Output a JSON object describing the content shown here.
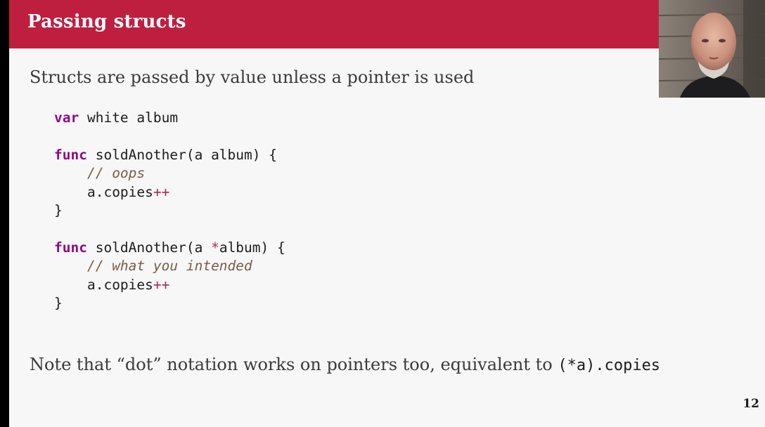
{
  "slide": {
    "title": "Passing structs",
    "lead": "Structs are passed by value unless a pointer is used",
    "code": {
      "line1_kw": "var",
      "line1_rest": " white album",
      "line3_kw": "func",
      "line3_rest": " soldAnother(a album) {",
      "line4_comment": "// oops",
      "line5_text": "a.copies",
      "line5_op": "++",
      "line6": "}",
      "line8_kw": "func",
      "line8_pre": " soldAnother(a ",
      "line8_op": "*",
      "line8_post": "album) {",
      "line9_comment": "// what you intended",
      "line10_text": "a.copies",
      "line10_op": "++",
      "line11": "}"
    },
    "note_text": "Note that “dot” notation works on pointers too, equivalent to ",
    "note_code": "(*a).copies",
    "page_number": "12"
  },
  "webcam": {
    "description": "presenter webcam"
  }
}
